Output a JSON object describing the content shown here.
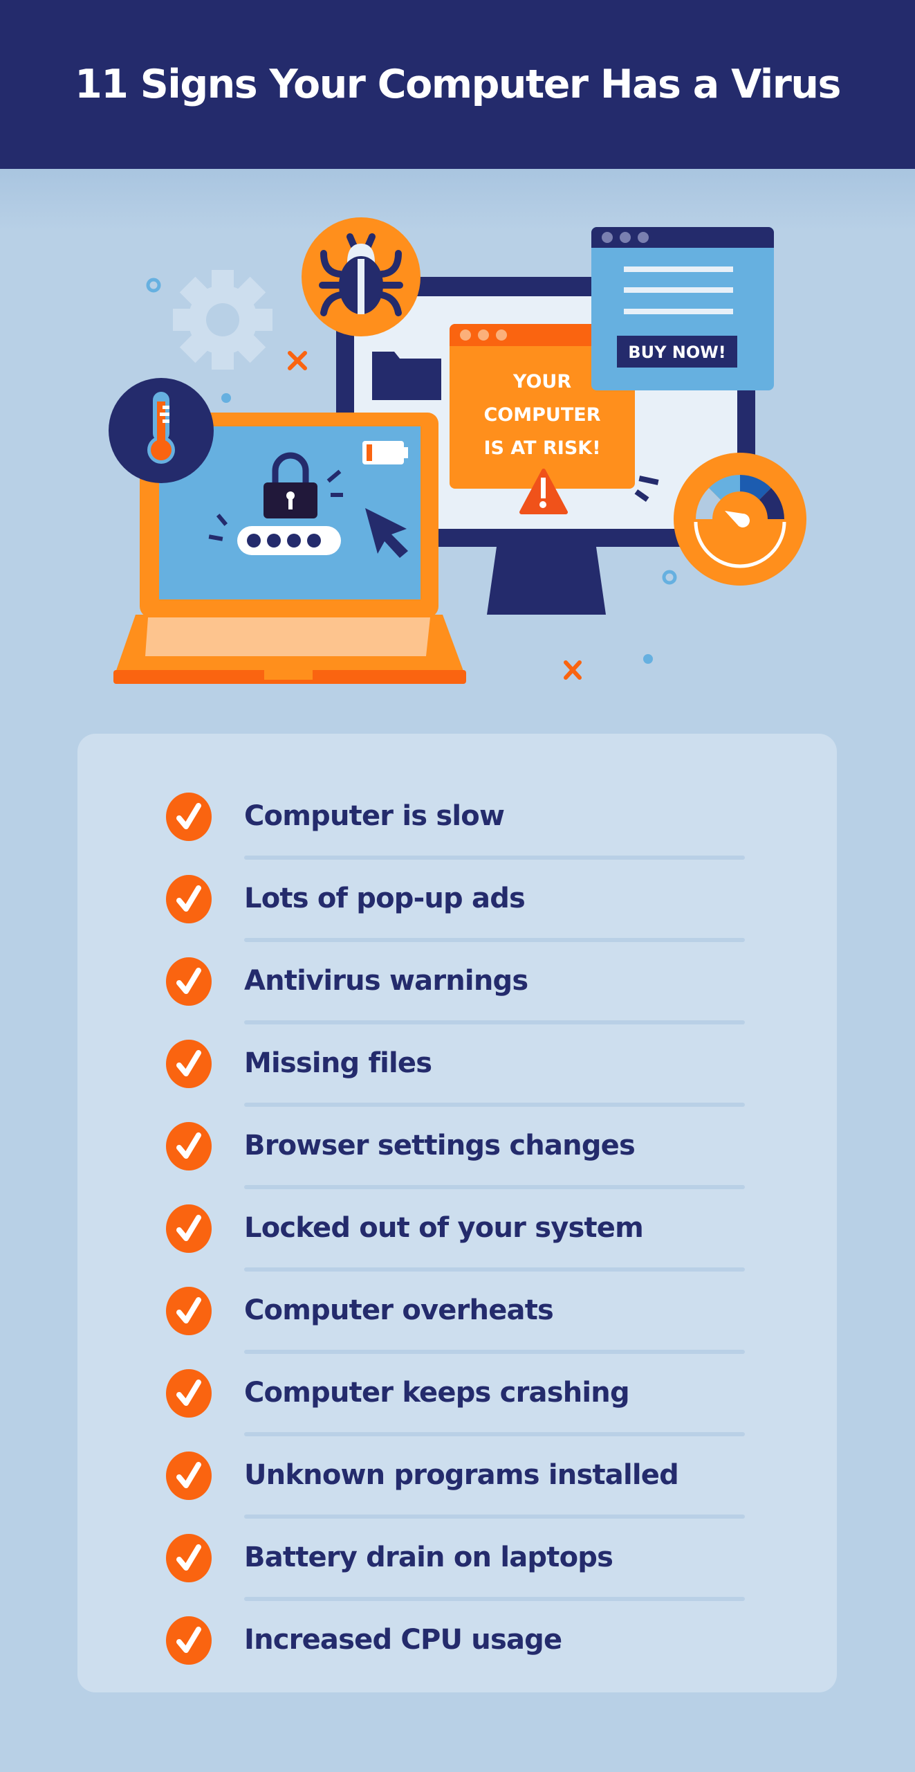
{
  "header": {
    "title": "11 Signs Your Computer Has a Virus"
  },
  "illustration": {
    "alert_popup": {
      "lines": [
        "YOUR",
        "COMPUTER",
        "IS AT RISK!"
      ]
    },
    "ad_popup": {
      "button_label": "BUY NOW!"
    },
    "icons": [
      "gear-icon",
      "bug-icon",
      "thermometer-icon",
      "padlock-icon",
      "password-field-icon",
      "low-battery-icon",
      "cursor-icon",
      "warning-icon",
      "folder-icon",
      "gauge-icon"
    ]
  },
  "checklist": {
    "items": [
      {
        "label": "Computer is slow"
      },
      {
        "label": "Lots of pop-up ads"
      },
      {
        "label": "Antivirus warnings"
      },
      {
        "label": "Missing files"
      },
      {
        "label": "Browser settings changes"
      },
      {
        "label": "Locked out of your system"
      },
      {
        "label": "Computer overheats"
      },
      {
        "label": "Computer keeps crashing"
      },
      {
        "label": "Unknown programs installed"
      },
      {
        "label": "Battery drain on laptops"
      },
      {
        "label": "Increased CPU usage"
      }
    ]
  },
  "colors": {
    "navy": "#242b6c",
    "orange": "#ff8f1c",
    "red_orange": "#fa6410",
    "sky": "#66b0e0",
    "background": "#b8d0e6",
    "panel": "#cddeee"
  }
}
